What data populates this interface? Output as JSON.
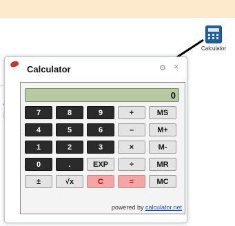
{
  "page": {
    "partial_text_1": "c",
    "partial_text_2": "p"
  },
  "desktop_icon": {
    "label": "Calculator",
    "icon": "calculator-icon"
  },
  "calculator": {
    "title": "Calculator",
    "display": "0",
    "rows": [
      [
        {
          "label": "7",
          "style": "dark"
        },
        {
          "label": "8",
          "style": "dark"
        },
        {
          "label": "9",
          "style": "dark"
        },
        {
          "label": "+",
          "style": "light"
        },
        {
          "label": "MS",
          "style": "light"
        }
      ],
      [
        {
          "label": "4",
          "style": "dark"
        },
        {
          "label": "5",
          "style": "dark"
        },
        {
          "label": "6",
          "style": "dark"
        },
        {
          "label": "–",
          "style": "light"
        },
        {
          "label": "M+",
          "style": "light"
        }
      ],
      [
        {
          "label": "1",
          "style": "dark"
        },
        {
          "label": "2",
          "style": "dark"
        },
        {
          "label": "3",
          "style": "dark"
        },
        {
          "label": "×",
          "style": "light"
        },
        {
          "label": "M-",
          "style": "light"
        }
      ],
      [
        {
          "label": "0",
          "style": "dark"
        },
        {
          "label": ".",
          "style": "dark"
        },
        {
          "label": "EXP",
          "style": "light"
        },
        {
          "label": "÷",
          "style": "light"
        },
        {
          "label": "MR",
          "style": "light"
        }
      ],
      [
        {
          "label": "±",
          "style": "light"
        },
        {
          "label": "√x",
          "style": "light"
        },
        {
          "label": "C",
          "style": "red"
        },
        {
          "label": "=",
          "style": "red"
        },
        {
          "label": "MC",
          "style": "light"
        }
      ]
    ],
    "powered_prefix": "powered by ",
    "powered_link": "calculator.net"
  },
  "colors": {
    "banner": "#fde9cc",
    "display_bg": "#b8c9a1",
    "key_dark": "#2b2b2b",
    "key_light": "#e3e3e3",
    "key_red": "#f4a6a6"
  }
}
